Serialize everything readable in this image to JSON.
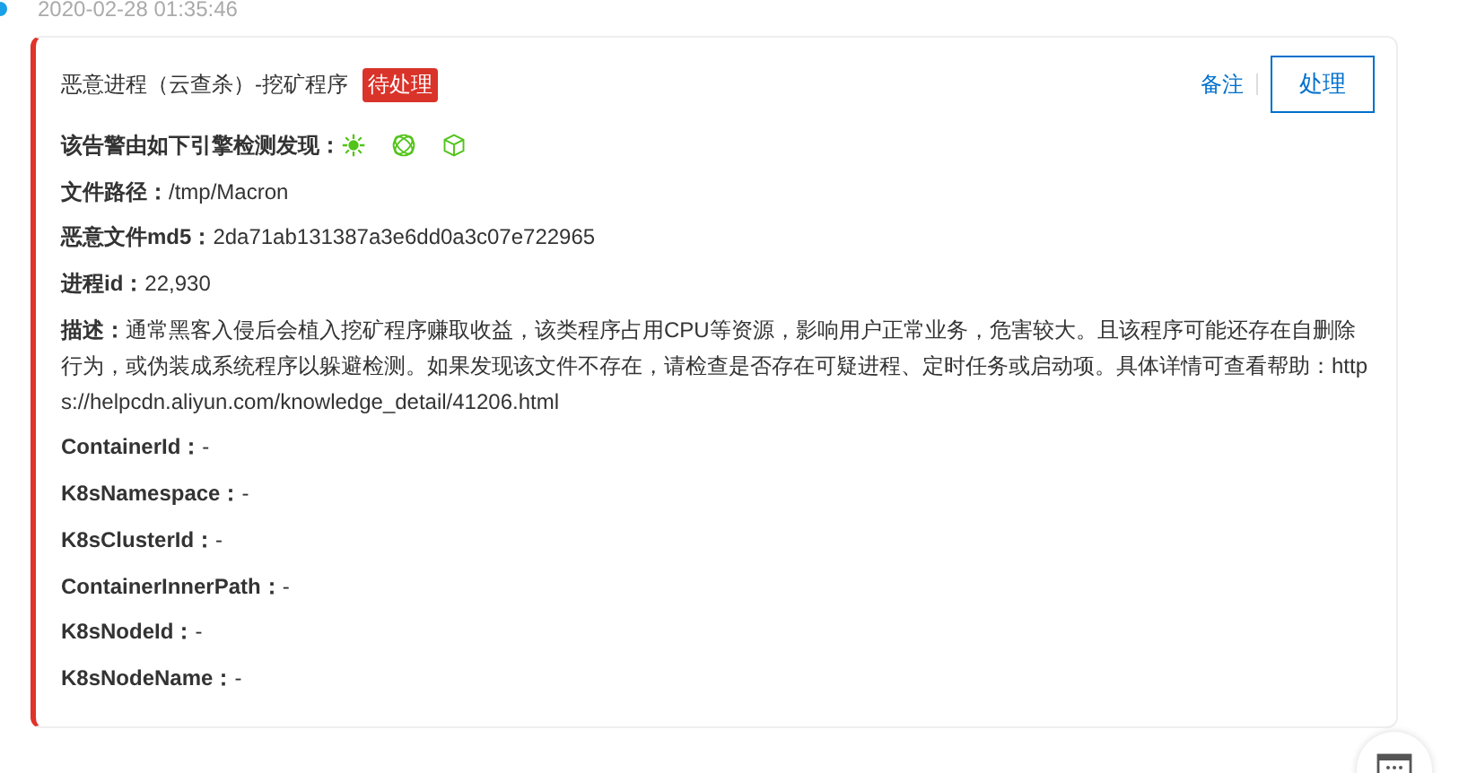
{
  "timestamp": "2020-02-28 01:35:46",
  "alert": {
    "title": "恶意进程（云查杀）-挖矿程序",
    "status": "待处理",
    "actions": {
      "note": "备注",
      "handle": "处理"
    },
    "engines_label": "该告警由如下引擎检测发现：",
    "fields": [
      "**文件路径：**/tmp/Macron",
      "**恶意文件md5：**2da71ab131387a3e6dd0a3c07e722965",
      "**进程id：**22,930",
      "**描述：**通常黑客入侵后会植入挖矿程序赚取收益，该类程序占用CPU等资源，影响用户正常业务，危害较大。且该程序可能还存在自删除行为，或伪装成系统程序以躲避检测。如果发现该文件不存在，请检查是否存在可疑进程、定时任务或启动项。具体详情可查看帮助：https://helpcdn.aliyun.com/knowledge_detail/41206.html",
      "**ContainerId：**-",
      "**K8sNamespace：**-",
      "**K8sClusterId：**-",
      "**ContainerInnerPath：**-",
      "**K8sNodeId：**-",
      "**K8sNodeName：**-"
    ]
  }
}
